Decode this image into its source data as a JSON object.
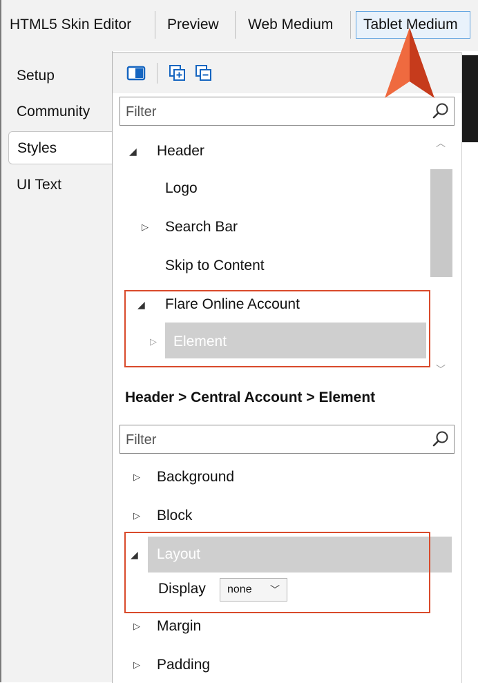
{
  "top_tabs": [
    {
      "label": "HTML5 Skin Editor"
    },
    {
      "label": "Preview"
    },
    {
      "label": "Web Medium"
    },
    {
      "label": "Tablet Medium",
      "active": true
    }
  ],
  "side_tabs": [
    {
      "label": "Setup"
    },
    {
      "label": "Community"
    },
    {
      "label": "Styles",
      "active": true
    },
    {
      "label": "UI Text"
    }
  ],
  "toolbar": {
    "icons": [
      "layout-toggle-icon",
      "expand-all-icon",
      "collapse-all-icon"
    ]
  },
  "tree_filter": {
    "placeholder": "Filter"
  },
  "tree": [
    {
      "label": "Header",
      "state": "expanded"
    },
    {
      "label": "Logo",
      "state": "leaf"
    },
    {
      "label": "Search Bar",
      "state": "collapsed"
    },
    {
      "label": "Skip to Content",
      "state": "leaf"
    },
    {
      "label": "Flare Online Account",
      "state": "expanded"
    },
    {
      "label": "Element",
      "state": "collapsed",
      "selected": true
    }
  ],
  "breadcrumb": "Header > Central Account > Element",
  "props_filter": {
    "placeholder": "Filter"
  },
  "properties": [
    {
      "label": "Background",
      "state": "collapsed"
    },
    {
      "label": "Block",
      "state": "collapsed"
    },
    {
      "label": "Layout",
      "state": "expanded",
      "selected": true
    },
    {
      "label": "Margin",
      "state": "collapsed"
    },
    {
      "label": "Padding",
      "state": "collapsed"
    }
  ],
  "display_setting": {
    "label": "Display",
    "value": "none"
  },
  "colors": {
    "highlight_border": "#d94a2b",
    "pointer": "#e4572e",
    "selection": "#cfcfcf",
    "active_tab_border": "#5fa3e0"
  }
}
